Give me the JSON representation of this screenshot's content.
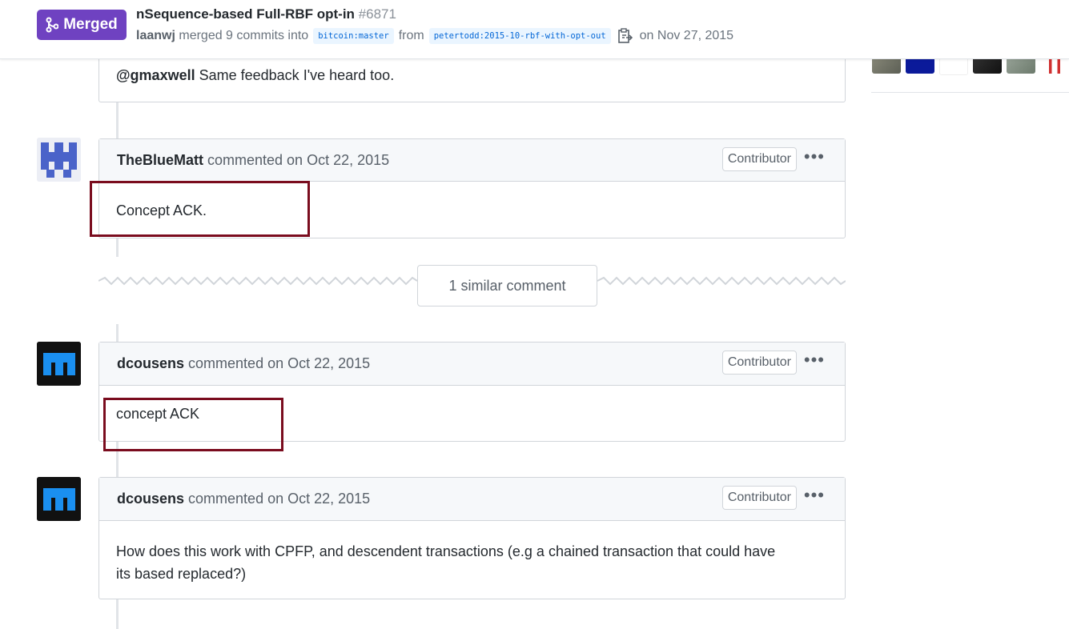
{
  "header": {
    "status": "Merged",
    "title": "nSequence-based Full-RBF opt-in",
    "number": "#6871",
    "author": "laanwj",
    "merged_text": "merged 9 commits into",
    "base_branch": "bitcoin:master",
    "from_text": "from",
    "head_branch": "petertodd:2015-10-rbf-with-opt-out",
    "date_text": "on Nov 27, 2015"
  },
  "colors": {
    "merged": "#6f42c1",
    "highlight": "#7a0c1e",
    "link_blue": "#0366d6"
  },
  "top_comment": {
    "mention": "@gmaxwell",
    "text": "Same feedback I've heard too."
  },
  "comments": [
    {
      "user": "TheBlueMatt",
      "meta": "commented on Oct 22, 2015",
      "badge": "Contributor",
      "body": "Concept ACK."
    },
    {
      "user": "dcousens",
      "meta": "commented on Oct 22, 2015",
      "badge": "Contributor",
      "body": "concept ACK"
    },
    {
      "user": "dcousens",
      "meta": "commented on Oct 22, 2015",
      "badge": "Contributor",
      "body_line1": "How does this work with CPFP, and descendent transactions (e.g a chained transaction that could have",
      "body_line2": "its based replaced?)"
    }
  ],
  "similar": {
    "label": "1 similar comment"
  },
  "icons": [
    "git-merge-icon",
    "copy-icon",
    "kebab-icon",
    "identicon-avatar"
  ]
}
